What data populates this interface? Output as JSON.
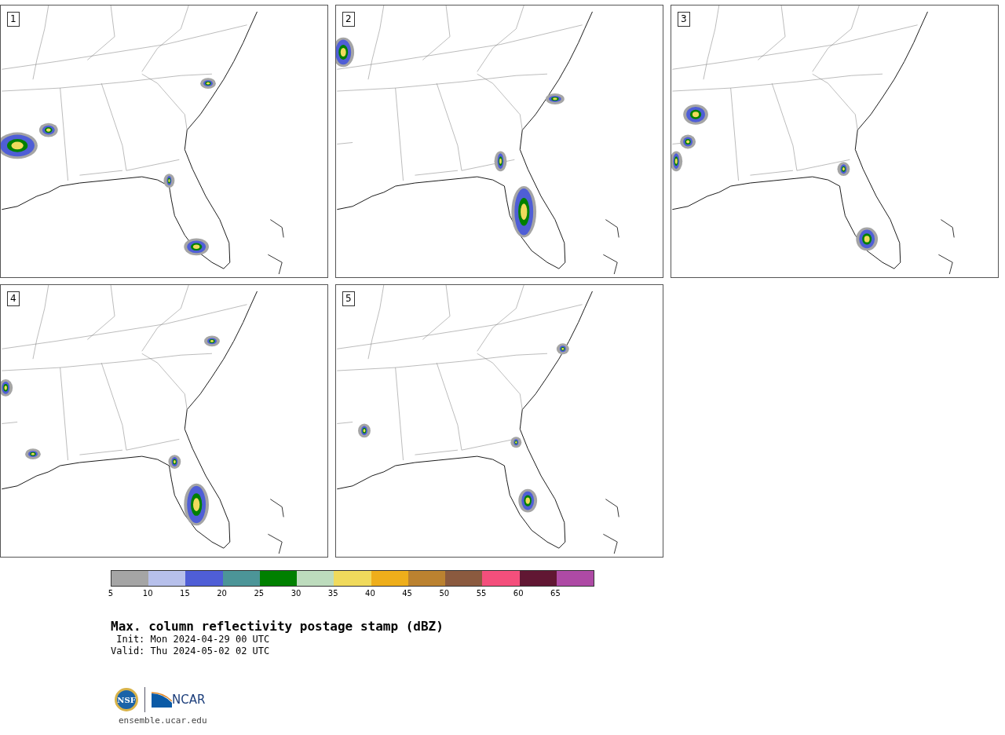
{
  "panels": [
    {
      "label": "1"
    },
    {
      "label": "2"
    },
    {
      "label": "3"
    },
    {
      "label": "4"
    },
    {
      "label": "5"
    }
  ],
  "colorbar": {
    "segments": [
      {
        "color": "#a5a5a5"
      },
      {
        "color": "#b7c0eb"
      },
      {
        "color": "#4f5ed6"
      },
      {
        "color": "#4c9598"
      },
      {
        "color": "#008000"
      },
      {
        "color": "#bddcbd"
      },
      {
        "color": "#f0da5c"
      },
      {
        "color": "#eeae1b"
      },
      {
        "color": "#bb8230"
      },
      {
        "color": "#8b5a3f"
      },
      {
        "color": "#f44f7c"
      },
      {
        "color": "#611733"
      },
      {
        "color": "#ae4aa5"
      }
    ],
    "ticks": [
      "5",
      "10",
      "15",
      "20",
      "25",
      "30",
      "35",
      "40",
      "45",
      "50",
      "55",
      "60",
      "65"
    ]
  },
  "title": "Max. column reflectivity postage stamp (dBZ)",
  "init": " Init: Mon 2024-04-29 00 UTC",
  "valid": "Valid: Thu 2024-05-02 02 UTC",
  "logo": {
    "nsf": "NSF",
    "ncar": "NCAR"
  },
  "site": "ensemble.ucar.edu"
}
